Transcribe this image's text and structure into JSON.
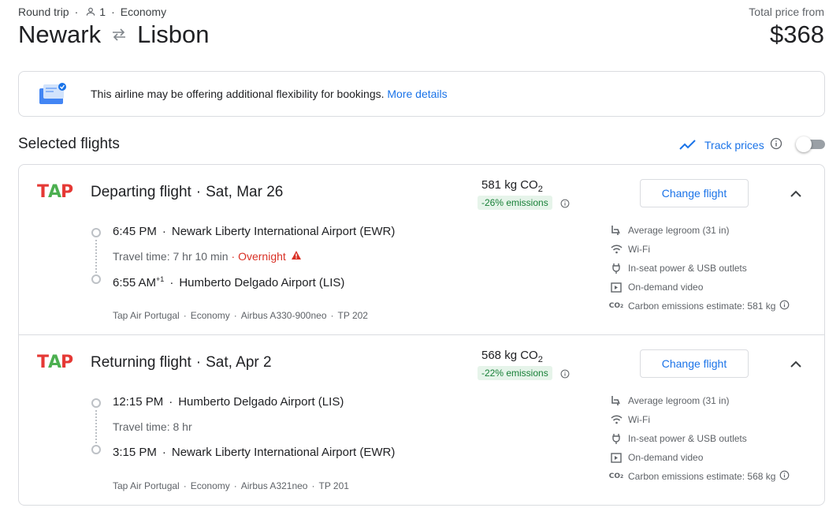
{
  "header": {
    "trip_type": "Round trip",
    "passengers": "1",
    "cabin": "Economy",
    "origin": "Newark",
    "destination": "Lisbon",
    "price_label": "Total price from",
    "price": "$368"
  },
  "banner": {
    "text": "This airline may be offering additional flexibility for bookings.",
    "link": "More details"
  },
  "section": {
    "title": "Selected flights",
    "track_label": "Track prices",
    "track_enabled": false
  },
  "colors": {
    "accent": "#1a73e8",
    "overnight": "#d93025",
    "emissions_green": "#188038"
  },
  "flights": [
    {
      "title": "Departing flight",
      "date": "Sat, Mar 26",
      "co2": "581 kg CO",
      "co2_sub": "2",
      "emissions": "-26% emissions",
      "change_label": "Change flight",
      "depart_time": "6:45 PM",
      "depart_airport": "Newark Liberty International Airport (EWR)",
      "travel_time": "Travel time: 7 hr 10 min",
      "overnight": "Overnight",
      "arrive_time": "6:55 AM",
      "arrive_plus": "+1",
      "arrive_airport": "Humberto Delgado Airport (LIS)",
      "airline": "Tap Air Portugal",
      "cabin": "Economy",
      "aircraft": "Airbus A330-900neo",
      "flight_no": "TP 202",
      "amenities": [
        {
          "icon": "legroom-icon",
          "label": "Average legroom (31 in)"
        },
        {
          "icon": "wifi-icon",
          "label": "Wi-Fi"
        },
        {
          "icon": "power-plug-icon",
          "label": "In-seat power & USB outlets"
        },
        {
          "icon": "video-icon",
          "label": "On-demand video"
        },
        {
          "icon": "co2-icon",
          "label": "Carbon emissions estimate: 581 kg"
        }
      ]
    },
    {
      "title": "Returning flight",
      "date": "Sat, Apr 2",
      "co2": "568 kg CO",
      "co2_sub": "2",
      "emissions": "-22% emissions",
      "change_label": "Change flight",
      "depart_time": "12:15 PM",
      "depart_airport": "Humberto Delgado Airport (LIS)",
      "travel_time": "Travel time: 8 hr",
      "arrive_time": "3:15 PM",
      "arrive_airport": "Newark Liberty International Airport (EWR)",
      "airline": "Tap Air Portugal",
      "cabin": "Economy",
      "aircraft": "Airbus A321neo",
      "flight_no": "TP 201",
      "amenities": [
        {
          "icon": "legroom-icon",
          "label": "Average legroom (31 in)"
        },
        {
          "icon": "wifi-icon",
          "label": "Wi-Fi"
        },
        {
          "icon": "power-plug-icon",
          "label": "In-seat power & USB outlets"
        },
        {
          "icon": "video-icon",
          "label": "On-demand video"
        },
        {
          "icon": "co2-icon",
          "label": "Carbon emissions estimate: 568 kg"
        }
      ]
    }
  ]
}
